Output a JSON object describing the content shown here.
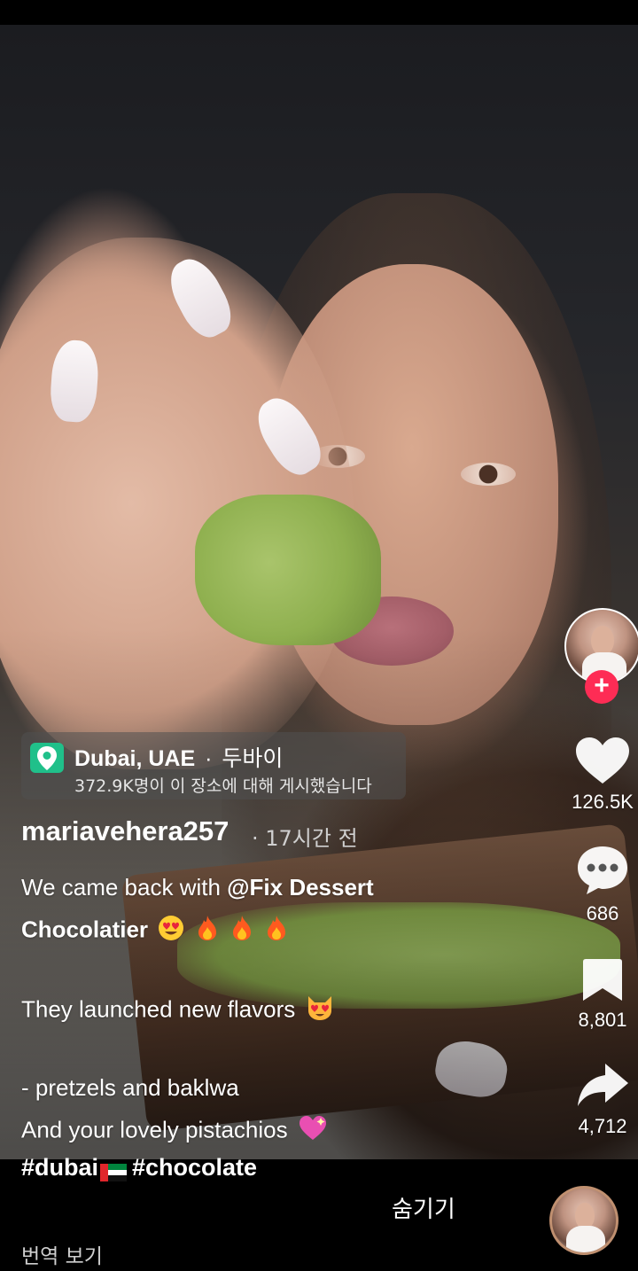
{
  "location": {
    "name": "Dubai, UAE",
    "separator": "·",
    "local_name": "두바이",
    "posts_text": "372.9K명이 이 장소에 대해 게시했습니다"
  },
  "post": {
    "username": "mariavehera257",
    "time": "· 17시간 전",
    "caption_line1_text": "We came back with ",
    "caption_line1_mention": "@Fix Dessert",
    "caption_line2_mention": "Chocolatier",
    "caption_line3": "They launched new flavors",
    "caption_line4": "- pretzels and baklwa",
    "caption_line5": "And your lovely pistachios",
    "hashtag1": "#dubai",
    "hashtag2": "#chocolate"
  },
  "actions": {
    "likes": "126.5K",
    "comments": "686",
    "saves": "8,801",
    "shares": "4,712"
  },
  "footer": {
    "hide_label": "숨기기",
    "translate_label": "번역 보기"
  },
  "icons": {
    "follow": "+",
    "location": "map-pin-icon",
    "like": "heart-icon",
    "comment": "comment-icon",
    "save": "bookmark-icon",
    "share": "share-icon"
  },
  "colors": {
    "follow_red": "#fe2c55",
    "location_green": "#20c08a"
  }
}
